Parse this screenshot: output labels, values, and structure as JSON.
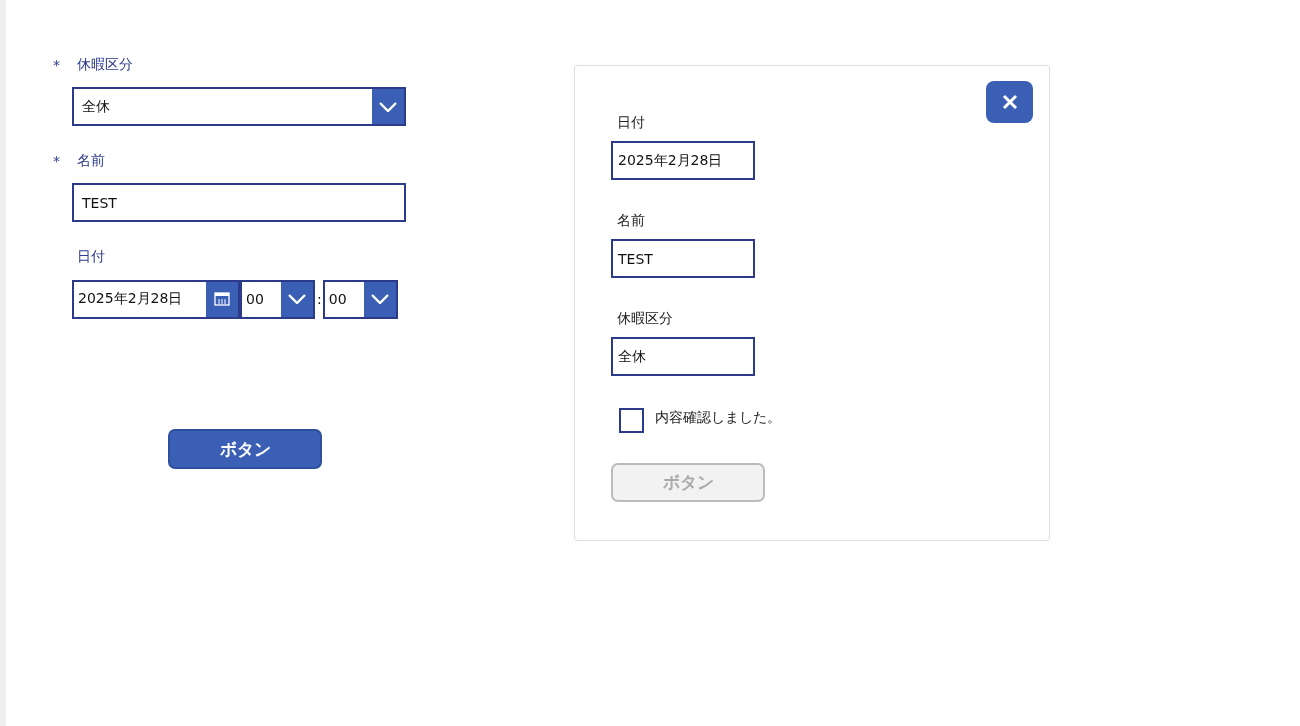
{
  "form": {
    "fields": [
      {
        "kind": "dropdown",
        "marker": "*",
        "label": "休暇区分",
        "value": "全休"
      },
      {
        "kind": "text",
        "marker": "*",
        "label": "名前",
        "value": "TEST"
      },
      {
        "kind": "datetime",
        "label": "日付",
        "date": "2025年2月28日",
        "hour": "00",
        "separator": ":",
        "minute": "00"
      }
    ],
    "button": {
      "label": "ボタン",
      "disabled": false
    }
  },
  "dialog": {
    "fields": [
      {
        "label": "日付",
        "value": "2025年2月28日"
      },
      {
        "label": "名前",
        "value": "TEST"
      },
      {
        "label": "休暇区分",
        "value": "全休"
      }
    ],
    "confirm": {
      "label": "内容確認しました。",
      "checked": false
    },
    "button": {
      "label": "ボタン",
      "disabled": true
    }
  }
}
